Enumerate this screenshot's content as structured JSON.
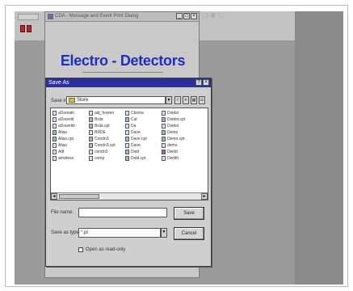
{
  "background_app": {
    "label": "",
    "faint_controls": "▢ ▣ ▢"
  },
  "app_window": {
    "title": "CDA - Message and Event Print Dialog",
    "brand": "Electro - Detectors",
    "win_buttons": [
      "_",
      "□",
      "×"
    ]
  },
  "dialog": {
    "title": "Save As",
    "help": "?",
    "close": "×",
    "save_in_label": "Save in:",
    "save_in_value": "Store",
    "tool_buttons": [
      "⇧",
      "✦",
      "▦",
      "☰"
    ],
    "files": [
      [
        {
          "name": "aDomain",
          "kind": "doc"
        },
        {
          "name": "aDownld",
          "kind": "doc"
        },
        {
          "name": "aDownldr",
          "kind": "doc"
        },
        {
          "name": "Alias",
          "kind": "img"
        },
        {
          "name": "Alias.cpt",
          "kind": "img"
        },
        {
          "name": "Alias",
          "kind": "doc"
        },
        {
          "name": "Attl",
          "kind": "doc"
        },
        {
          "name": "amdress",
          "kind": "doc"
        }
      ],
      [
        {
          "name": "adj_howen",
          "kind": "doc"
        },
        {
          "name": "Brda",
          "kind": "img"
        },
        {
          "name": "Brda.cpt",
          "kind": "img"
        },
        {
          "name": "BRDE",
          "kind": "doc"
        },
        {
          "name": "Condn3",
          "kind": "img"
        },
        {
          "name": "Condn3.cpt",
          "kind": "img"
        },
        {
          "name": "condn3",
          "kind": "doc"
        },
        {
          "name": "comp",
          "kind": "doc"
        }
      ],
      [
        {
          "name": "Cbxma",
          "kind": "doc"
        },
        {
          "name": "Cul",
          "kind": "img"
        },
        {
          "name": "Da",
          "kind": "doc"
        },
        {
          "name": "Dave",
          "kind": "doc"
        },
        {
          "name": "Dave.cpt",
          "kind": "img"
        },
        {
          "name": "Dave",
          "kind": "doc"
        },
        {
          "name": "Dstd",
          "kind": "img"
        },
        {
          "name": "Dstd.cpt",
          "kind": "img"
        }
      ],
      [
        {
          "name": "Dstdst",
          "kind": "doc"
        },
        {
          "name": "Dstdst.cpt",
          "kind": "img"
        },
        {
          "name": "Dstdst",
          "kind": "doc"
        },
        {
          "name": "Demo",
          "kind": "img"
        },
        {
          "name": "Demo.cpt",
          "kind": "img"
        },
        {
          "name": "demo",
          "kind": "doc"
        },
        {
          "name": "Dwdd",
          "kind": "app"
        },
        {
          "name": "Dwdth",
          "kind": "doc"
        }
      ]
    ],
    "file_name_label": "File name:",
    "file_name_value": "",
    "save_type_label": "Save as type:",
    "save_type_value": "*.pt",
    "save_button": "Save",
    "cancel_button": "Cancel",
    "readonly_label": "Open as read-only"
  },
  "colors": {
    "brand_blue": "#1e2fc0",
    "dialog_title_bar": "#2b2f9a"
  }
}
